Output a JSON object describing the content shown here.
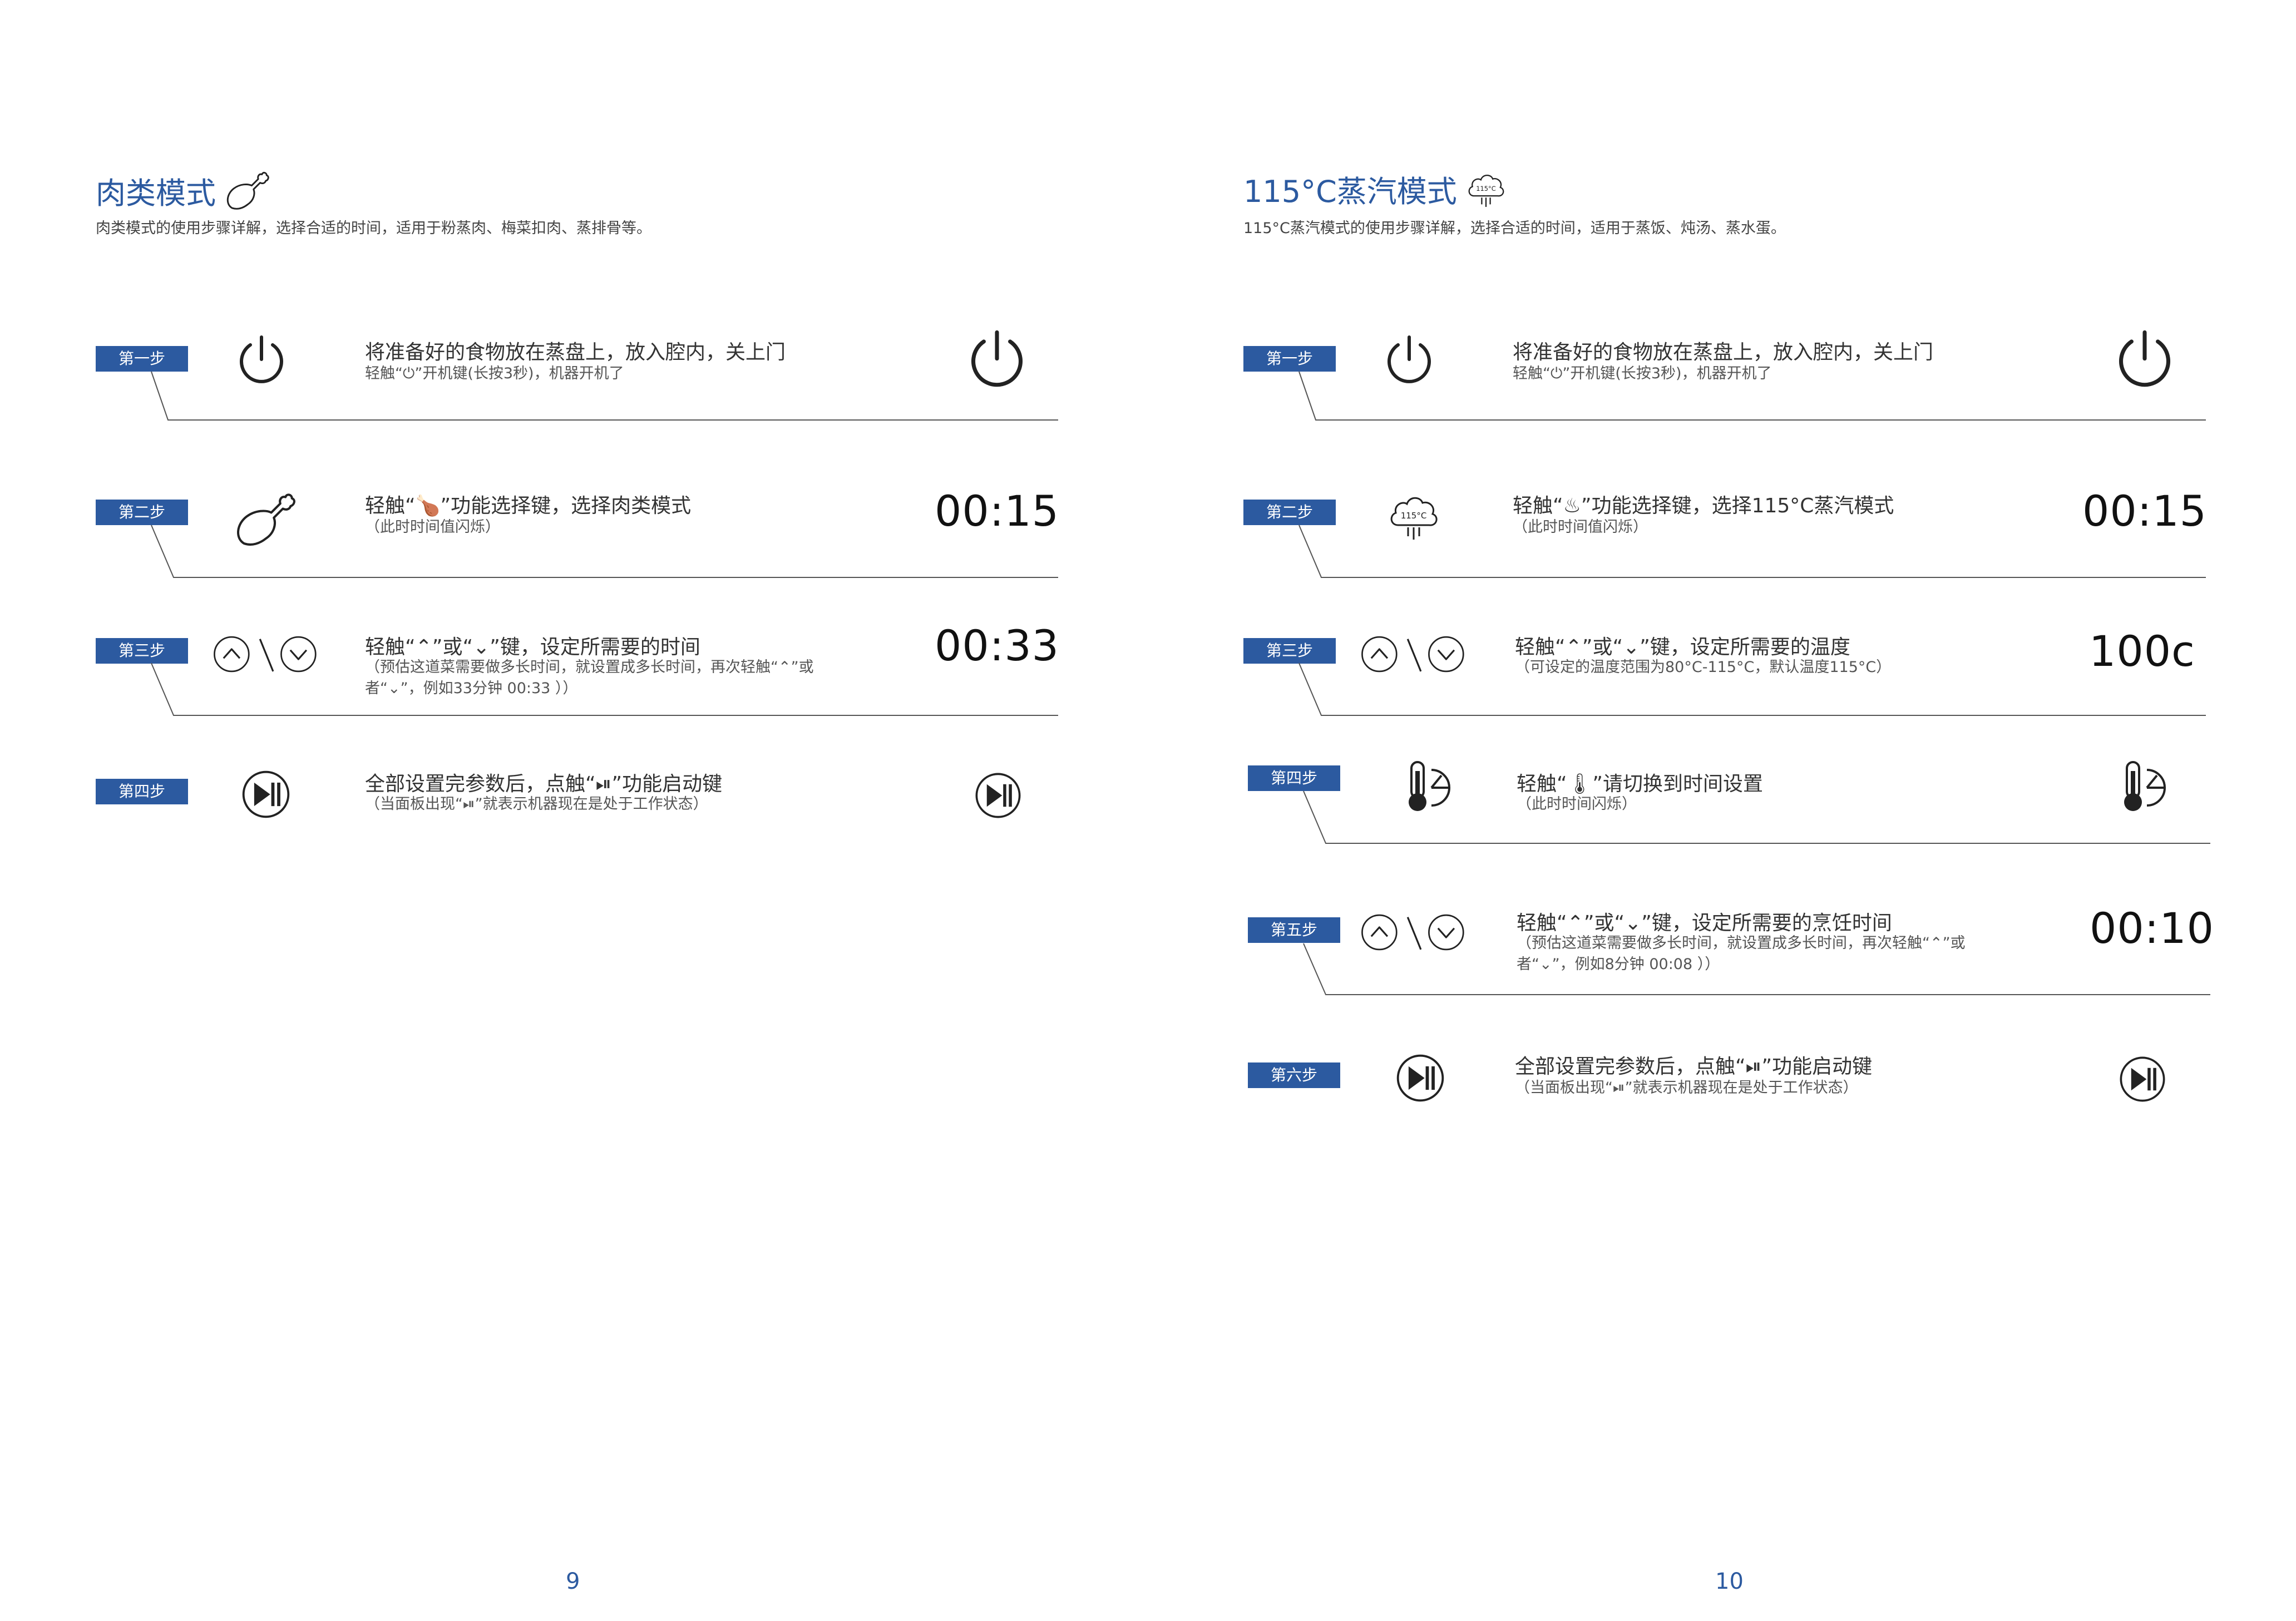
{
  "left": {
    "title": "肉类模式",
    "title_icon": "drumstick-icon",
    "subtitle": "肉类模式的使用步骤详解，选择合适的时间，适用于粉蒸肉、梅菜扣肉、蒸排骨等。",
    "steps": [
      {
        "label": "第一步",
        "icon": "power-icon",
        "main": "将准备好的食物放在蒸盘上，放入腔内，关上门",
        "sub": [
          "轻触“⏻”开机键(长按3秒)，机器开机了"
        ],
        "display_icon": "power-icon",
        "display_text": ""
      },
      {
        "label": "第二步",
        "icon": "drumstick-icon",
        "main": "轻触“🍗”功能选择键，选择肉类模式",
        "sub": [
          "（此时时间值闪烁）"
        ],
        "display_text": "00:15"
      },
      {
        "label": "第三步",
        "icon": "up-down-icon",
        "main": "轻触“⌃”或“⌄”键，设定所需要的时间",
        "sub": [
          "（预估这道菜需要做多长时间，就设置成多长时间，再次轻触“⌃”或",
          "者“⌄”，例如33分钟 00:33 ））"
        ],
        "display_text": "00:33"
      },
      {
        "label": "第四步",
        "icon": "play-pause-icon",
        "main": "全部设置完参数后，点触“⏯”功能启动键",
        "sub": [
          "（当面板出现“⏯”就表示机器现在是处于工作状态）"
        ],
        "display_icon": "play-pause-icon",
        "display_text": ""
      }
    ],
    "page_number": "9"
  },
  "right": {
    "title": "115°C蒸汽模式",
    "title_icon": "steam-115-icon",
    "subtitle": "115°C蒸汽模式的使用步骤详解，选择合适的时间，适用于蒸饭、炖汤、蒸水蛋。",
    "steps": [
      {
        "label": "第一步",
        "icon": "power-icon",
        "main": "将准备好的食物放在蒸盘上，放入腔内，关上门",
        "sub": [
          "轻触“⏻”开机键(长按3秒)，机器开机了"
        ],
        "display_icon": "power-icon",
        "display_text": ""
      },
      {
        "label": "第二步",
        "icon": "steam-115-icon",
        "main": "轻触“♨”功能选择键，选择115°C蒸汽模式",
        "sub": [
          "（此时时间值闪烁）"
        ],
        "display_text": "00:15"
      },
      {
        "label": "第三步",
        "icon": "up-down-icon",
        "main": "轻触“⌃”或“⌄”键，设定所需要的温度",
        "sub": [
          "（可设定的温度范围为80°C-115°C，默认温度115°C）"
        ],
        "display_text": "100c"
      },
      {
        "label": "第四步",
        "icon": "thermometer-timer-icon",
        "main": "轻触“🌡”请切换到时间设置",
        "sub": [
          "（此时时间闪烁）"
        ],
        "display_icon": "thermometer-timer-icon",
        "display_text": ""
      },
      {
        "label": "第五步",
        "icon": "up-down-icon",
        "main": "轻触“⌃”或“⌄”键，设定所需要的烹饪时间",
        "sub": [
          "（预估这道菜需要做多长时间，就设置成多长时间，再次轻触“⌃”或",
          "者“⌄”，例如8分钟 00:08 ））"
        ],
        "display_text": "00:10"
      },
      {
        "label": "第六步",
        "icon": "play-pause-icon",
        "main": "全部设置完参数后，点触“⏯”功能启动键",
        "sub": [
          "（当面板出现“⏯”就表示机器现在是处于工作状态）"
        ],
        "display_icon": "play-pause-icon",
        "display_text": ""
      }
    ],
    "page_number": "10"
  },
  "colors": {
    "accent": "#2c5aa0",
    "line": "#555555",
    "text": "#333333"
  }
}
